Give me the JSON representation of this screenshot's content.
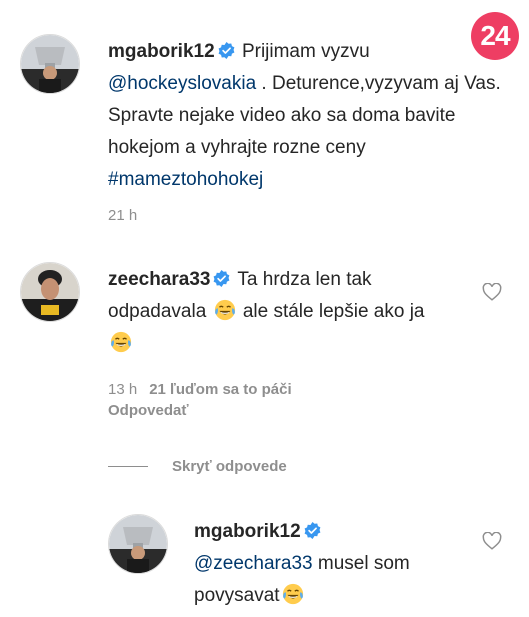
{
  "badge": {
    "text": "24",
    "color": "#ee3e63"
  },
  "colors": {
    "link": "#00376b",
    "muted": "#8e8e8e",
    "text": "#262626",
    "verified": "#3897f0"
  },
  "comments": [
    {
      "username": "mgaborik12",
      "verified": true,
      "text_parts": [
        "Prijimam vyzvu ",
        "@hockeyslovakia",
        " . Deturence,vyzyvam aj Vas. Spravte nejake video ako sa doma bavite hokejom a vyhrajte rozne ceny ",
        "#mameztohohokej"
      ],
      "time": "21 h"
    },
    {
      "username": "zeechara33",
      "verified": true,
      "text_parts": [
        "Ta hrdza len tak odpadavala ",
        " ale stále lepšie ako ja "
      ],
      "emoji": "face-with-tears-of-joy",
      "time": "13 h",
      "likes": "21 ľuďom sa to páči",
      "reply": "Odpovedať"
    }
  ],
  "hide_replies": "Skryť odpovede",
  "reply": {
    "username": "mgaborik12",
    "verified": true,
    "mention": "@zeechara33",
    "text": " musel som povysavat",
    "emoji": "face-with-tears-of-joy"
  },
  "icons": {
    "like": "heart-icon",
    "verified": "verified-badge-icon"
  }
}
